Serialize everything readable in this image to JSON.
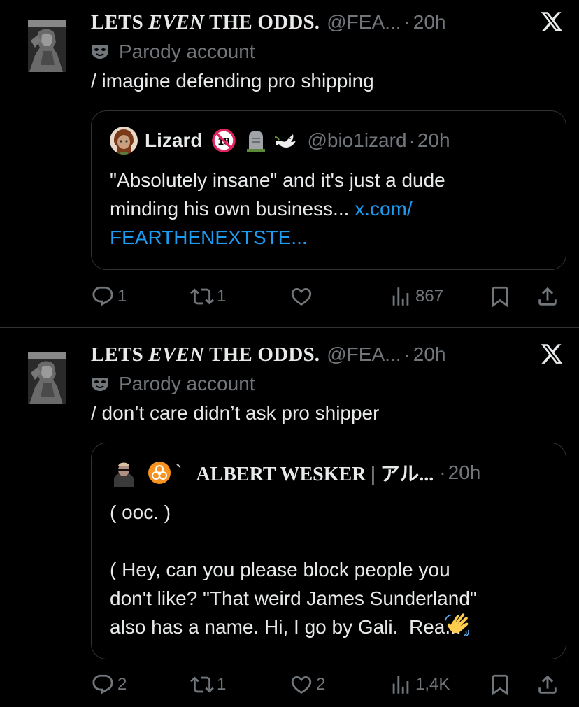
{
  "tweets": [
    {
      "author_name_pre": "LETS ",
      "author_name_em": "EVEN",
      "author_name_post": " THE ODDS.",
      "handle": "@FEA...",
      "dot": "·",
      "time": "20h",
      "badge_icon": "theater-mask-icon",
      "badge_label": "Parody account",
      "text": "/ imagine defending pro shipping",
      "quote": {
        "author_name": "Lizard",
        "name_emojis": [
          "no-under-18-icon",
          "headstone-icon",
          "dove-icon"
        ],
        "handle": "@bio1izard",
        "dot": "·",
        "time": "20h",
        "text": "\"Absolutely insane\" and it's just a dude\nminding his own business... ",
        "link_line1": "x.com/",
        "link_line2": "FEARTHENEXTSTE..."
      },
      "actions": {
        "replies": "1",
        "reposts": "1",
        "likes": "",
        "views": "867"
      }
    },
    {
      "author_name_pre": "LETS ",
      "author_name_em": "EVEN",
      "author_name_post": " THE ODDS.",
      "handle": "@FEA...",
      "dot": "·",
      "time": "20h",
      "badge_icon": "theater-mask-icon",
      "badge_label": "Parody account",
      "text": "/ don’t care didn’t ask pro shipper",
      "quote": {
        "author_prefix": "`",
        "author_name": "ALBERT WESKER | アル...",
        "name_emojis": [
          "biohazard-icon"
        ],
        "dot": "·",
        "time": "20h",
        "text": "( ooc. )\n\n( Hey, can you please block people you\ndon't like? \"That weird James Sunderland\"\nalso has a name. Hi, I go by Gali.  Rea..."
      },
      "actions": {
        "replies": "2",
        "reposts": "1",
        "likes": "2",
        "views": "1,4K"
      }
    }
  ],
  "colors": {
    "background": "#000000",
    "text": "#e7e9ea",
    "muted": "#71767b",
    "link": "#1d9bf0",
    "border": "#2f3336"
  }
}
